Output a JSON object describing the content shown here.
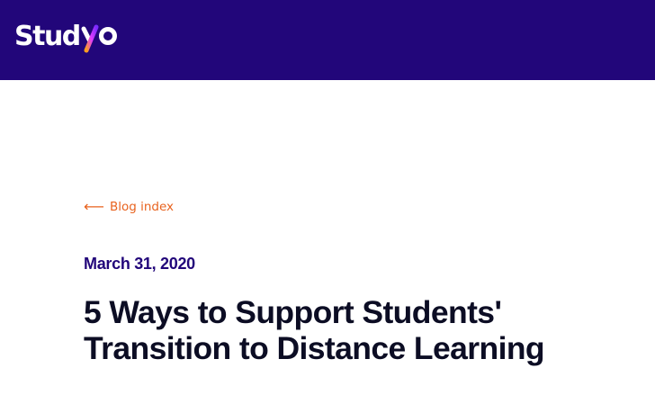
{
  "header": {
    "brand": "Studyo",
    "colors": {
      "background": "#22067a",
      "logo_text": "#ffffff",
      "accent_gradient": [
        "#ff9f1c",
        "#e23bff",
        "#7a2bff"
      ]
    }
  },
  "nav": {
    "back_link_label": "Blog index",
    "back_icon": "arrow-left-icon",
    "link_color": "#e8631f"
  },
  "article": {
    "date": "March 31, 2020",
    "title": "5 Ways to Support Students' Transition to Distance Learning",
    "date_color": "#22067a",
    "title_color": "#0c0d24"
  }
}
